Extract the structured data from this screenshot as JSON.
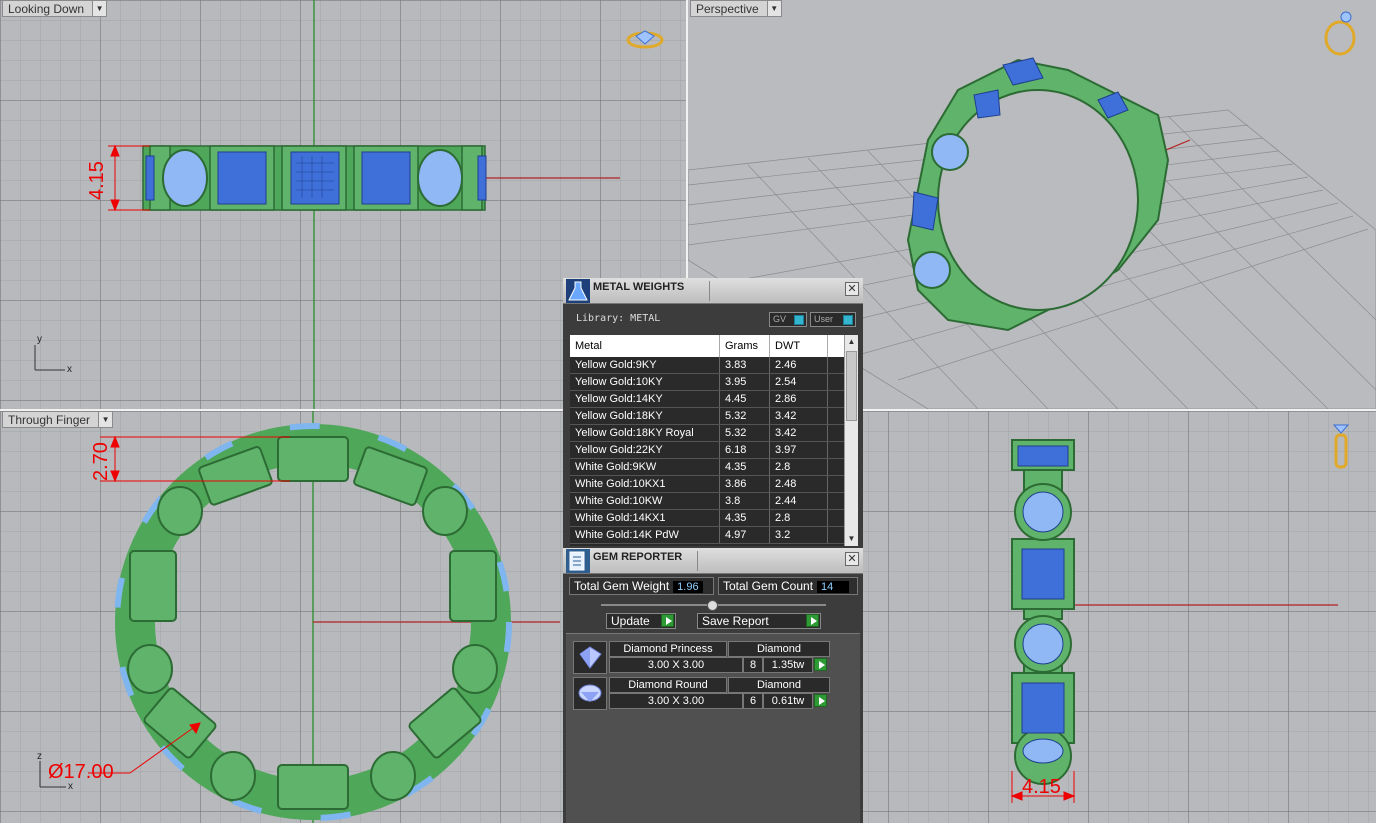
{
  "viewports": {
    "top": {
      "label": "Looking Down",
      "dimension": "4.15",
      "axis_x": "x",
      "axis_y": "y"
    },
    "perspective": {
      "label": "Perspective"
    },
    "front": {
      "label": "Through Finger",
      "dimension_height": "2.70",
      "dimension_diameter": "Ø17.00",
      "axis_x": "x",
      "axis_z": "z"
    },
    "right": {
      "dimension": "4.15"
    }
  },
  "metal_weights": {
    "title": "METAL WEIGHTS",
    "library_label": "Library: METAL",
    "toggle_gv": "GV",
    "toggle_user": "User",
    "columns": [
      "Metal",
      "Grams",
      "DWT"
    ],
    "rows": [
      [
        "Yellow Gold:9KY",
        "3.83",
        "2.46"
      ],
      [
        "Yellow Gold:10KY",
        "3.95",
        "2.54"
      ],
      [
        "Yellow Gold:14KY",
        "4.45",
        "2.86"
      ],
      [
        "Yellow Gold:18KY",
        "5.32",
        "3.42"
      ],
      [
        "Yellow Gold:18KY Royal",
        "5.32",
        "3.42"
      ],
      [
        "Yellow Gold:22KY",
        "6.18",
        "3.97"
      ],
      [
        "White Gold:9KW",
        "4.35",
        "2.8"
      ],
      [
        "White Gold:10KX1",
        "3.86",
        "2.48"
      ],
      [
        "White Gold:10KW",
        "3.8",
        "2.44"
      ],
      [
        "White Gold:14KX1",
        "4.35",
        "2.8"
      ],
      [
        "White Gold:14K PdW",
        "4.97",
        "3.2"
      ]
    ]
  },
  "gem_reporter": {
    "title": "GEM REPORTER",
    "total_weight_label": "Total Gem Weight",
    "total_weight_value": "1.96",
    "total_count_label": "Total Gem Count",
    "total_count_value": "14",
    "update_label": "Update",
    "save_label": "Save Report",
    "gems": [
      {
        "name": "Diamond Princess",
        "material": "Diamond",
        "size": "3.00 X 3.00",
        "count": "8",
        "weight": "1.35tw"
      },
      {
        "name": "Diamond Round",
        "material": "Diamond",
        "size": "3.00 X 3.00",
        "count": "6",
        "weight": "0.61tw"
      }
    ]
  },
  "colors": {
    "metal_green": "#5fb36a",
    "gem_blue": "#3f6fd8",
    "dimension_red": "#e00000"
  }
}
